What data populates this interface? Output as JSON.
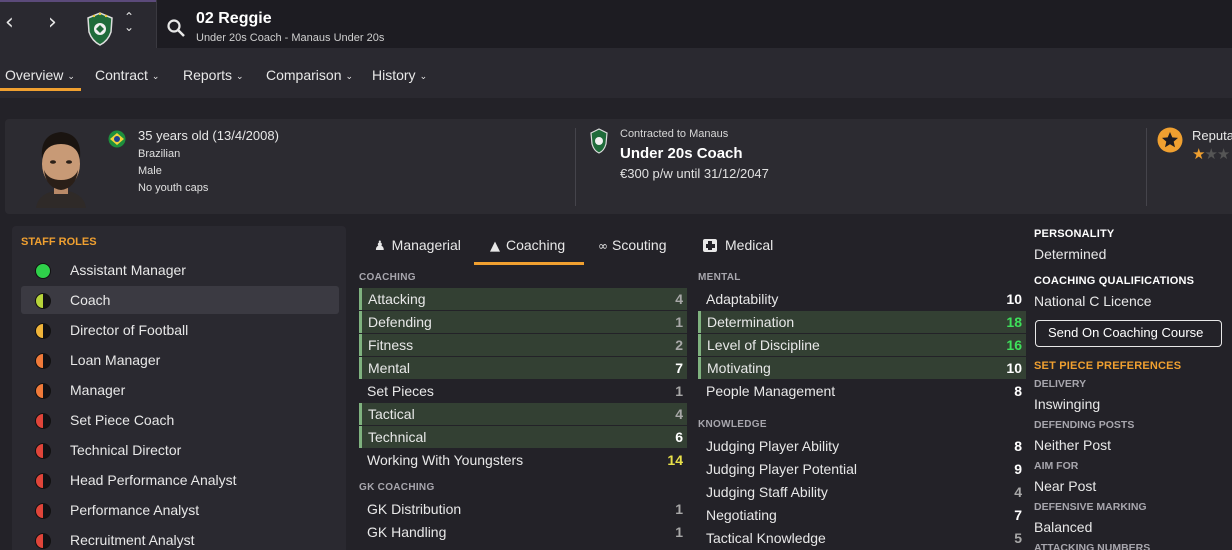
{
  "header": {
    "name": "02 Reggie",
    "subtitle": "Under 20s Coach - Manaus Under 20s"
  },
  "nav": {
    "back": "‹",
    "forward": "›",
    "up": "⌃",
    "down": "⌄"
  },
  "tabs": [
    {
      "label": "Overview"
    },
    {
      "label": "Contract"
    },
    {
      "label": "Reports"
    },
    {
      "label": "Comparison"
    },
    {
      "label": "History"
    }
  ],
  "profile": {
    "age": "35 years old (13/4/2008)",
    "nationality": "Brazilian",
    "gender": "Male",
    "caps": "No youth caps"
  },
  "contract": {
    "club_line": "Contracted to Manaus",
    "role": "Under 20s Coach",
    "wage": "€300 p/w until 31/12/2047"
  },
  "reputation": {
    "label": "Reputa",
    "stars": 1,
    "max": 3
  },
  "staff_roles": {
    "title": "STAFF ROLES",
    "items": [
      {
        "label": "Assistant Manager",
        "color": "#2fd04a",
        "fill": 1.0
      },
      {
        "label": "Coach",
        "color": "#b7d43a",
        "fill": 0.5
      },
      {
        "label": "Director of Football",
        "color": "#f0b43a",
        "fill": 0.5
      },
      {
        "label": "Loan Manager",
        "color": "#f07a3a",
        "fill": 0.5
      },
      {
        "label": "Manager",
        "color": "#f07a3a",
        "fill": 0.5
      },
      {
        "label": "Set Piece Coach",
        "color": "#e0453a",
        "fill": 0.5
      },
      {
        "label": "Technical Director",
        "color": "#e0453a",
        "fill": 0.5
      },
      {
        "label": "Head Performance Analyst",
        "color": "#e0453a",
        "fill": 0.5
      },
      {
        "label": "Performance Analyst",
        "color": "#e0453a",
        "fill": 0.5
      },
      {
        "label": "Recruitment Analyst",
        "color": "#e0453a",
        "fill": 0.5
      }
    ]
  },
  "attr_tabs": [
    {
      "label": "Managerial",
      "icon": "person-icon"
    },
    {
      "label": "Coaching",
      "icon": "cone-icon"
    },
    {
      "label": "Scouting",
      "icon": "binoculars-icon"
    },
    {
      "label": "Medical",
      "icon": "medkit-icon"
    }
  ],
  "coaching": {
    "title": "COACHING",
    "items": [
      {
        "name": "Attacking",
        "value": "4",
        "hl": true,
        "color": "#a8a8a8"
      },
      {
        "name": "Defending",
        "value": "1",
        "hl": true,
        "color": "#a8a8a8"
      },
      {
        "name": "Fitness",
        "value": "2",
        "hl": true,
        "color": "#a8a8a8"
      },
      {
        "name": "Mental",
        "value": "7",
        "hl": true,
        "color": "#ffffff"
      },
      {
        "name": "Set Pieces",
        "value": "1",
        "hl": false,
        "color": "#a8a8a8"
      },
      {
        "name": "Tactical",
        "value": "4",
        "hl": true,
        "color": "#a8a8a8"
      },
      {
        "name": "Technical",
        "value": "6",
        "hl": true,
        "color": "#ffffff"
      },
      {
        "name": "Working With Youngsters",
        "value": "14",
        "hl": false,
        "color": "#e8e04a"
      }
    ]
  },
  "gk": {
    "title": "GK COACHING",
    "items": [
      {
        "name": "GK Distribution",
        "value": "1",
        "hl": false,
        "color": "#a8a8a8"
      },
      {
        "name": "GK Handling",
        "value": "1",
        "hl": false,
        "color": "#a8a8a8"
      }
    ]
  },
  "mental": {
    "title": "MENTAL",
    "items": [
      {
        "name": "Adaptability",
        "value": "10",
        "hl": false,
        "color": "#ffffff"
      },
      {
        "name": "Determination",
        "value": "18",
        "hl": true,
        "color": "#3ee05a"
      },
      {
        "name": "Level of Discipline",
        "value": "16",
        "hl": true,
        "color": "#3ee05a"
      },
      {
        "name": "Motivating",
        "value": "10",
        "hl": true,
        "color": "#ffffff"
      },
      {
        "name": "People Management",
        "value": "8",
        "hl": false,
        "color": "#ffffff"
      }
    ]
  },
  "knowledge": {
    "title": "KNOWLEDGE",
    "items": [
      {
        "name": "Judging Player Ability",
        "value": "8",
        "hl": false,
        "color": "#ffffff"
      },
      {
        "name": "Judging Player Potential",
        "value": "9",
        "hl": false,
        "color": "#ffffff"
      },
      {
        "name": "Judging Staff Ability",
        "value": "4",
        "hl": false,
        "color": "#a8a8a8"
      },
      {
        "name": "Negotiating",
        "value": "7",
        "hl": false,
        "color": "#ffffff"
      },
      {
        "name": "Tactical Knowledge",
        "value": "5",
        "hl": false,
        "color": "#a8a8a8"
      }
    ]
  },
  "right": {
    "personality_title": "PERSONALITY",
    "personality": "Determined",
    "quals_title": "COACHING QUALIFICATIONS",
    "quals": "National C Licence",
    "course_button": "Send On Coaching Course",
    "setpiece_title": "SET PIECE PREFERENCES",
    "delivery_title": "DELIVERY",
    "delivery": "Inswinging",
    "defposts_title": "DEFENDING POSTS",
    "defposts": "Neither Post",
    "aim_title": "AIM FOR",
    "aim": "Near Post",
    "marking_title": "DEFENSIVE MARKING",
    "marking": "Balanced",
    "attnum_title": "ATTACKING NUMBERS"
  }
}
